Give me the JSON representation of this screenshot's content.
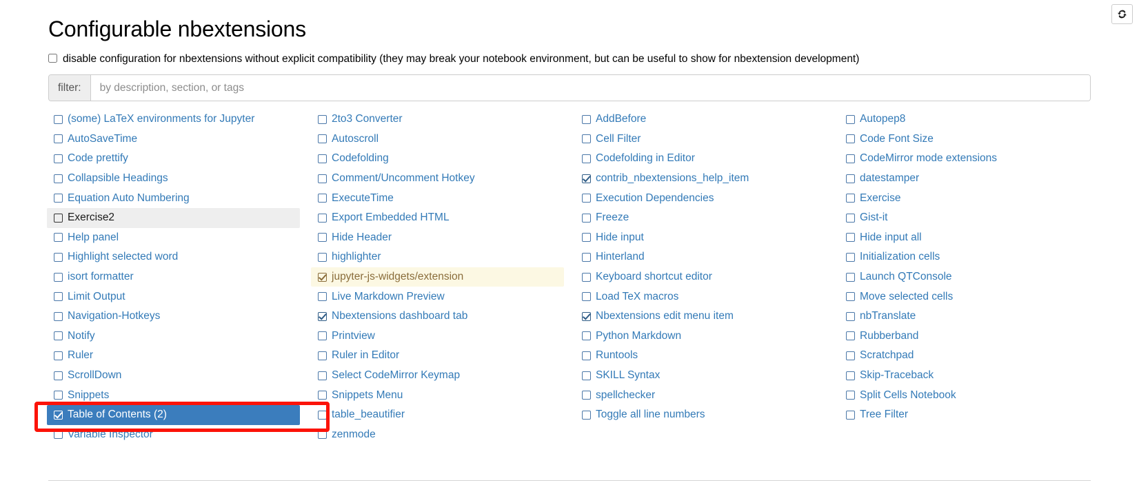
{
  "header": {
    "title": "Configurable nbextensions",
    "refresh_button_label": "refresh-nbextensions-list",
    "refresh_icon": "refresh-icon"
  },
  "disable_config": {
    "checked": false,
    "label": "disable configuration for nbextensions without explicit compatibility (they may break your notebook environment, but can be useful to show for nbextension development)"
  },
  "filter": {
    "addon_label": "filter:",
    "placeholder": "by description, section, or tags",
    "value": ""
  },
  "colors": {
    "link": "#337ab7",
    "selected_bg": "#3b7dbd",
    "hover_bg": "#eeeeee",
    "warn_bg": "#fcf8e3",
    "warn_text": "#8a6d3b",
    "annotation": "#fc1308"
  },
  "columns": [
    {
      "items": [
        {
          "label": "(some) LaTeX environments for Jupyter",
          "checked": false,
          "state": "normal"
        },
        {
          "label": "AutoSaveTime",
          "checked": false,
          "state": "normal"
        },
        {
          "label": "Code prettify",
          "checked": false,
          "state": "normal"
        },
        {
          "label": "Collapsible Headings",
          "checked": false,
          "state": "normal"
        },
        {
          "label": "Equation Auto Numbering",
          "checked": false,
          "state": "normal"
        },
        {
          "label": "Exercise2",
          "checked": false,
          "state": "hovered"
        },
        {
          "label": "Help panel",
          "checked": false,
          "state": "normal"
        },
        {
          "label": "Highlight selected word",
          "checked": false,
          "state": "normal"
        },
        {
          "label": "isort formatter",
          "checked": false,
          "state": "normal"
        },
        {
          "label": "Limit Output",
          "checked": false,
          "state": "normal"
        },
        {
          "label": "Navigation-Hotkeys",
          "checked": false,
          "state": "normal"
        },
        {
          "label": "Notify",
          "checked": false,
          "state": "normal"
        },
        {
          "label": "Ruler",
          "checked": false,
          "state": "normal"
        },
        {
          "label": "ScrollDown",
          "checked": false,
          "state": "normal"
        },
        {
          "label": "Snippets",
          "checked": false,
          "state": "normal"
        },
        {
          "label": "Table of Contents (2)",
          "checked": true,
          "state": "selected"
        },
        {
          "label": "Variable Inspector",
          "checked": false,
          "state": "normal"
        }
      ]
    },
    {
      "items": [
        {
          "label": "2to3 Converter",
          "checked": false,
          "state": "normal"
        },
        {
          "label": "Autoscroll",
          "checked": false,
          "state": "normal"
        },
        {
          "label": "Codefolding",
          "checked": false,
          "state": "normal"
        },
        {
          "label": "Comment/Uncomment Hotkey",
          "checked": false,
          "state": "normal"
        },
        {
          "label": "ExecuteTime",
          "checked": false,
          "state": "normal"
        },
        {
          "label": "Export Embedded HTML",
          "checked": false,
          "state": "normal"
        },
        {
          "label": "Hide Header",
          "checked": false,
          "state": "normal"
        },
        {
          "label": "highlighter",
          "checked": false,
          "state": "normal"
        },
        {
          "label": "jupyter-js-widgets/extension",
          "checked": true,
          "state": "warn"
        },
        {
          "label": "Live Markdown Preview",
          "checked": false,
          "state": "normal"
        },
        {
          "label": "Nbextensions dashboard tab",
          "checked": true,
          "state": "normal"
        },
        {
          "label": "Printview",
          "checked": false,
          "state": "normal"
        },
        {
          "label": "Ruler in Editor",
          "checked": false,
          "state": "normal"
        },
        {
          "label": "Select CodeMirror Keymap",
          "checked": false,
          "state": "normal"
        },
        {
          "label": "Snippets Menu",
          "checked": false,
          "state": "normal"
        },
        {
          "label": "table_beautifier",
          "checked": false,
          "state": "normal"
        },
        {
          "label": "zenmode",
          "checked": false,
          "state": "normal"
        }
      ]
    },
    {
      "items": [
        {
          "label": "AddBefore",
          "checked": false,
          "state": "normal"
        },
        {
          "label": "Cell Filter",
          "checked": false,
          "state": "normal"
        },
        {
          "label": "Codefolding in Editor",
          "checked": false,
          "state": "normal"
        },
        {
          "label": "contrib_nbextensions_help_item",
          "checked": true,
          "state": "normal"
        },
        {
          "label": "Execution Dependencies",
          "checked": false,
          "state": "normal"
        },
        {
          "label": "Freeze",
          "checked": false,
          "state": "normal"
        },
        {
          "label": "Hide input",
          "checked": false,
          "state": "normal"
        },
        {
          "label": "Hinterland",
          "checked": false,
          "state": "normal"
        },
        {
          "label": "Keyboard shortcut editor",
          "checked": false,
          "state": "normal"
        },
        {
          "label": "Load TeX macros",
          "checked": false,
          "state": "normal"
        },
        {
          "label": "Nbextensions edit menu item",
          "checked": true,
          "state": "normal"
        },
        {
          "label": "Python Markdown",
          "checked": false,
          "state": "normal"
        },
        {
          "label": "Runtools",
          "checked": false,
          "state": "normal"
        },
        {
          "label": "SKILL Syntax",
          "checked": false,
          "state": "normal"
        },
        {
          "label": "spellchecker",
          "checked": false,
          "state": "normal"
        },
        {
          "label": "Toggle all line numbers",
          "checked": false,
          "state": "normal"
        }
      ]
    },
    {
      "items": [
        {
          "label": "Autopep8",
          "checked": false,
          "state": "normal"
        },
        {
          "label": "Code Font Size",
          "checked": false,
          "state": "normal"
        },
        {
          "label": "CodeMirror mode extensions",
          "checked": false,
          "state": "normal"
        },
        {
          "label": "datestamper",
          "checked": false,
          "state": "normal"
        },
        {
          "label": "Exercise",
          "checked": false,
          "state": "normal"
        },
        {
          "label": "Gist-it",
          "checked": false,
          "state": "normal"
        },
        {
          "label": "Hide input all",
          "checked": false,
          "state": "normal"
        },
        {
          "label": "Initialization cells",
          "checked": false,
          "state": "normal"
        },
        {
          "label": "Launch QTConsole",
          "checked": false,
          "state": "normal"
        },
        {
          "label": "Move selected cells",
          "checked": false,
          "state": "normal"
        },
        {
          "label": "nbTranslate",
          "checked": false,
          "state": "normal"
        },
        {
          "label": "Rubberband",
          "checked": false,
          "state": "normal"
        },
        {
          "label": "Scratchpad",
          "checked": false,
          "state": "normal"
        },
        {
          "label": "Skip-Traceback",
          "checked": false,
          "state": "normal"
        },
        {
          "label": "Split Cells Notebook",
          "checked": false,
          "state": "normal"
        },
        {
          "label": "Tree Filter",
          "checked": false,
          "state": "normal"
        }
      ]
    }
  ],
  "annotation": {
    "shape": "rectangle",
    "target_label": "Table of Contents (2)"
  }
}
